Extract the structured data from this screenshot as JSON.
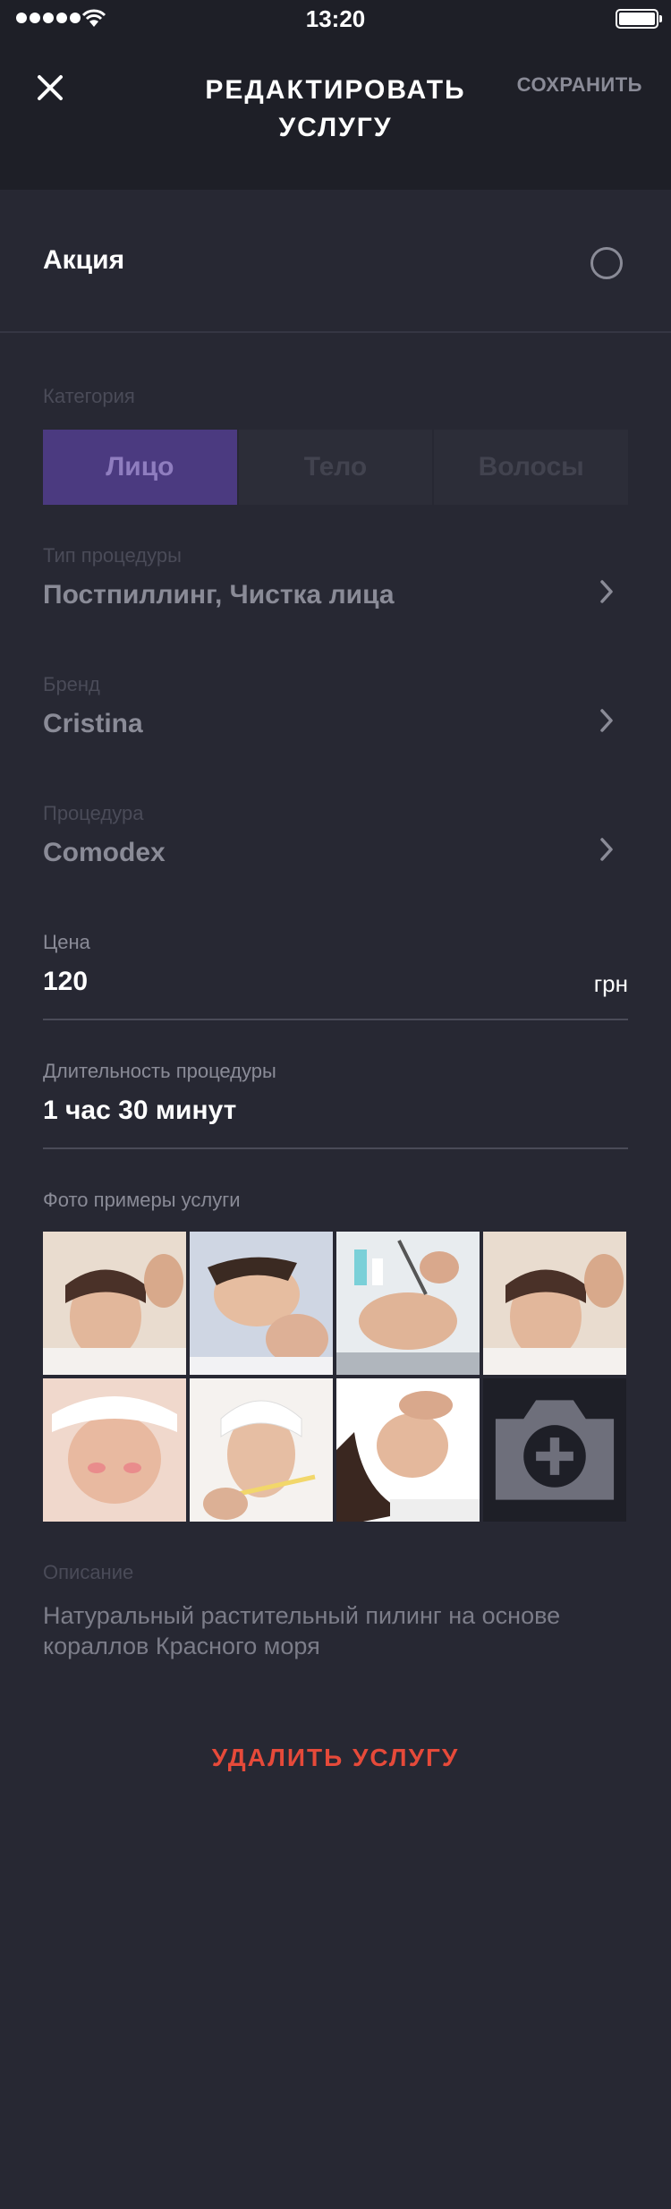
{
  "status_bar": {
    "time": "13:20"
  },
  "header": {
    "title": "РЕДАКТИРОВАТЬ УСЛУГУ",
    "save_label": "СОХРАНИТЬ"
  },
  "promo": {
    "label": "Акция",
    "checked": false
  },
  "category": {
    "label": "Категория",
    "options": [
      "Лицо",
      "Тело",
      "Волосы"
    ],
    "selected": "Лицо"
  },
  "procedure_type": {
    "label": "Тип процедуры",
    "value": "Постпиллинг, Чистка лица"
  },
  "brand": {
    "label": "Бренд",
    "value": "Cristina"
  },
  "procedure": {
    "label": "Процедура",
    "value": "Comodex"
  },
  "price": {
    "label": "Цена",
    "value": "120",
    "unit": "грн"
  },
  "duration": {
    "label": "Длительность процедуры",
    "value": "1 час 30 минут"
  },
  "photos": {
    "label": "Фото примеры услуги",
    "items": [
      "photo-1",
      "photo-2",
      "photo-3",
      "photo-4",
      "photo-5",
      "photo-6",
      "photo-7"
    ],
    "add_icon": "camera-add-icon"
  },
  "description": {
    "label": "Описание",
    "value": "Натуральный растительный пилинг на основе кораллов Красного моря"
  },
  "delete_label": "УДАЛИТЬ УСЛУГУ",
  "colors": {
    "background": "#272833",
    "accent": "#4b3a80",
    "danger": "#e64a3a"
  }
}
